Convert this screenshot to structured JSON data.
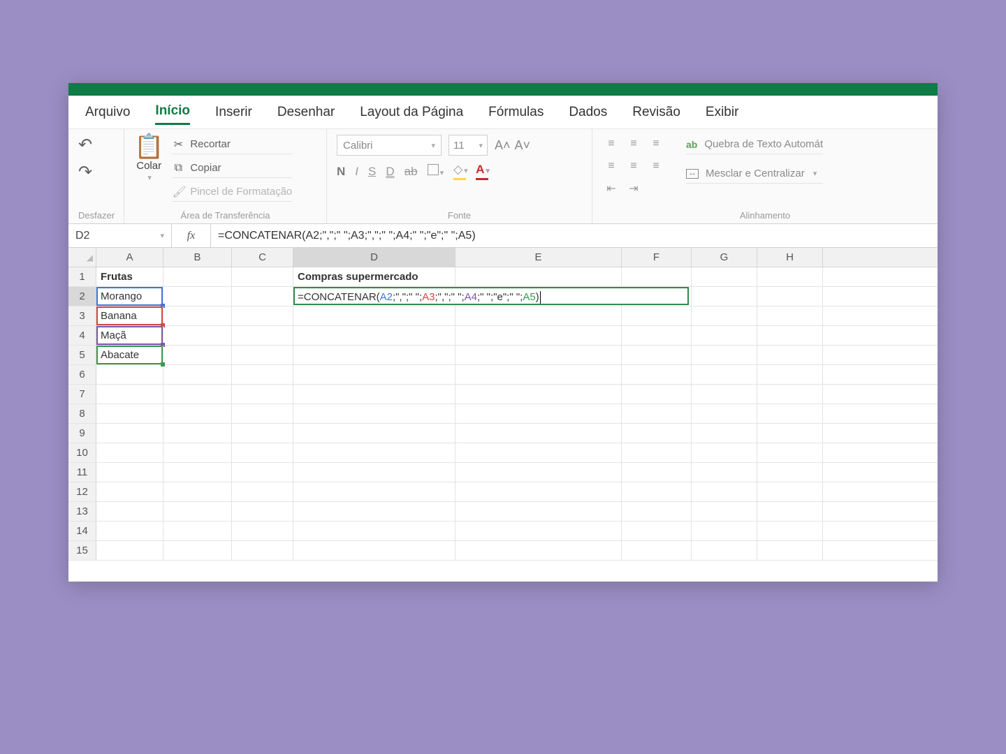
{
  "tabs": {
    "arquivo": "Arquivo",
    "inicio": "Início",
    "inserir": "Inserir",
    "desenhar": "Desenhar",
    "layout": "Layout da Página",
    "formulas": "Fórmulas",
    "dados": "Dados",
    "revisao": "Revisão",
    "exibir": "Exibir",
    "active": "inicio"
  },
  "ribbon": {
    "undo_group": "Desfazer",
    "clipboard": {
      "paste": "Colar",
      "cut": "Recortar",
      "copy": "Copiar",
      "format_painter": "Pincel de Formatação",
      "group_label": "Área de Transferência"
    },
    "font": {
      "name": "Calibri",
      "size": "11",
      "bold": "N",
      "italic": "I",
      "underline": "S",
      "double_underline": "D",
      "strike": "ab",
      "grow": "A˄",
      "shrink": "A˅",
      "group_label": "Fonte"
    },
    "alignment": {
      "wrap": "Quebra de Texto Automát",
      "merge": "Mesclar e Centralizar",
      "group_label": "Alinhamento",
      "ab_prefix": "ab"
    }
  },
  "formula_bar": {
    "name_box": "D2",
    "fx": "fx",
    "formula": "=CONCATENAR(A2;\",\";\" \";A3;\",\";\" \";A4;\" \";\"e\";\" \";A5)"
  },
  "columns": [
    "A",
    "B",
    "C",
    "D",
    "E",
    "F",
    "G",
    "H"
  ],
  "selected_column": "D",
  "selected_row": 2,
  "row_count": 15,
  "cells": {
    "A1": "Frutas",
    "A2": "Morango",
    "A3": "Banana",
    "A4": "Maçã",
    "A5": "Abacate",
    "D1": "Compras supermercado"
  },
  "editing_cell": {
    "ref": "D2",
    "parts": [
      {
        "t": "fn",
        "v": "=CONCATENAR("
      },
      {
        "t": "ref1",
        "v": "A2"
      },
      {
        "t": "fn",
        "v": ";\",\";\" \";"
      },
      {
        "t": "ref2",
        "v": "A3"
      },
      {
        "t": "fn",
        "v": ";\",\";\" \";"
      },
      {
        "t": "ref3",
        "v": "A4"
      },
      {
        "t": "fn",
        "v": ";\" \";\"e\";\" \";"
      },
      {
        "t": "ref4",
        "v": "A5"
      },
      {
        "t": "fn",
        "v": ")"
      }
    ]
  },
  "chart_data": {
    "type": "table",
    "columns": [
      "A",
      "B",
      "C",
      "D",
      "E",
      "F",
      "G",
      "H"
    ],
    "rows": [
      {
        "A": "Frutas",
        "D": "Compras supermercado"
      },
      {
        "A": "Morango",
        "D": "=CONCATENAR(A2;\",\";\" \";A3;\",\";\" \";A4;\" \";\"e\";\" \";A5)"
      },
      {
        "A": "Banana"
      },
      {
        "A": "Maçã"
      },
      {
        "A": "Abacate"
      }
    ]
  }
}
